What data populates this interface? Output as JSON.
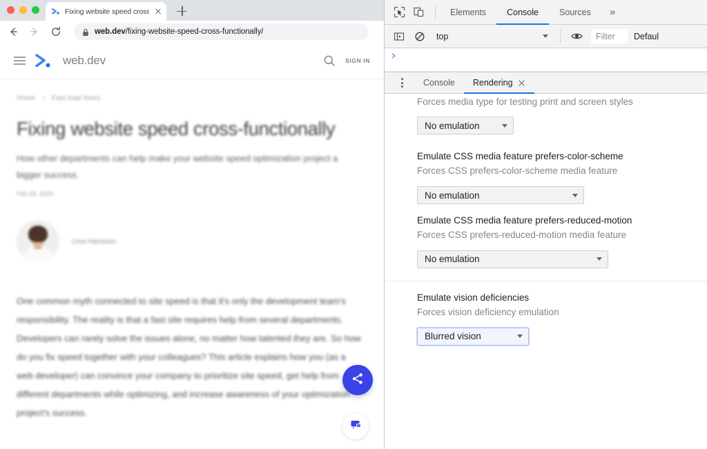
{
  "browser": {
    "tab": {
      "title": "Fixing website speed cross-fu",
      "favicon": "webdev-favicon",
      "close": "close-tab-icon"
    },
    "new_tab_label": "+",
    "nav": {
      "back": "back-arrow-icon",
      "forward": "forward-arrow-icon",
      "reload": "reload-icon"
    },
    "omnibox": {
      "lock": "lock-icon",
      "url_domain": "web.dev",
      "url_path": "/fixing-website-speed-cross-functionally/"
    }
  },
  "site": {
    "header": {
      "menu": "hamburger-icon",
      "logo": "webdev-logo",
      "brand": "web.dev",
      "search": "search-icon",
      "signin": "SIGN IN"
    },
    "breadcrumb": {
      "home": "Home",
      "separator": "›",
      "current": "Fast load times"
    },
    "article": {
      "title": "Fixing website speed cross-functionally",
      "subtitle": "How other departments can help make your website speed optimization project a bigger success.",
      "date": "Feb 28, 2020",
      "author": "Lina Hansson",
      "body": "One common myth connected to site speed is that it's only the development team's responsibility. The reality is that a fast site requires help from several departments. Developers can rarely solve the issues alone, no matter how talented they are. So how do you fix speed together with your colleagues? This article explains how you (as a web developer) can convince your company to prioritize site speed, get help from different departments while optimizing, and increase awareness of your optimization project's success."
    },
    "fab": {
      "share": "share-icon",
      "feedback": "feedback-icon",
      "share_color": "#3b42e8"
    }
  },
  "devtools": {
    "toolbar": {
      "inspect_icon": "inspect-element-icon",
      "device_icon": "device-toolbar-icon",
      "tabs": [
        {
          "label": "Elements",
          "active": false
        },
        {
          "label": "Console",
          "active": true
        },
        {
          "label": "Sources",
          "active": false
        }
      ],
      "more_tabs": "»",
      "active_underline_color": "#1a73e8"
    },
    "console_bar": {
      "sidebar_icon": "console-sidebar-icon",
      "clear_icon": "clear-console-icon",
      "context": "top",
      "eye_icon": "live-expression-eye-icon",
      "filter_placeholder": "Filter",
      "levels": "Defaul"
    },
    "drawer": {
      "kebab": "more-options-icon",
      "tabs": [
        {
          "label": "Console",
          "active": false,
          "closable": false
        },
        {
          "label": "Rendering",
          "active": true,
          "closable": true
        }
      ],
      "close_icon": "close-tab-icon"
    },
    "rendering": {
      "media_type_desc": "Forces media type for testing print and screen styles",
      "media_type_value": "No emulation",
      "sections": [
        {
          "title": "Emulate CSS media feature prefers-color-scheme",
          "desc": "Forces CSS prefers-color-scheme media feature",
          "value": "No emulation"
        },
        {
          "title": "Emulate CSS media feature prefers-reduced-motion",
          "desc": "Forces CSS prefers-reduced-motion media feature",
          "value": "No emulation"
        },
        {
          "title": "Emulate vision deficiencies",
          "desc": "Forces vision deficiency emulation",
          "value": "Blurred vision"
        }
      ]
    }
  }
}
